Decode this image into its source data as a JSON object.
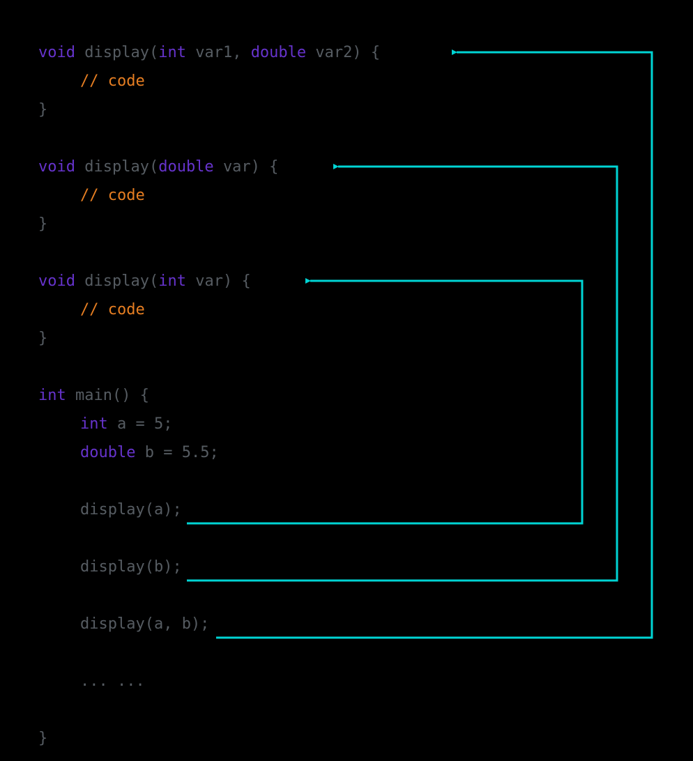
{
  "code": {
    "func1": {
      "ret": "void",
      "name": "display",
      "p1_type": "int",
      "p1_name": "var1",
      "sep": ", ",
      "p2_type": "double",
      "p2_name": "var2",
      "close": ") {",
      "comment": "// code",
      "end": "}"
    },
    "func2": {
      "ret": "void",
      "name": "display",
      "p1_type": "double",
      "p1_name": "var",
      "close": ") {",
      "comment": "// code",
      "end": "}"
    },
    "func3": {
      "ret": "void",
      "name": "display",
      "p1_type": "int",
      "p1_name": "var",
      "close": ") {",
      "comment": "// code",
      "end": "}"
    },
    "main": {
      "ret": "int",
      "name": "main() {",
      "decl1_type": "int",
      "decl1_rest": "a = 5;",
      "decl2_type": "double",
      "decl2_rest": "b = 5.5;",
      "call1": "display(a);",
      "call2": "display(b);",
      "call3": "display(a, b);",
      "ellipsis": "... ...",
      "end": "}"
    }
  },
  "arrows": {
    "color": "#00d4d4",
    "width": 3,
    "paths": [
      {
        "from": "call1",
        "to": "func3"
      },
      {
        "from": "call2",
        "to": "func2"
      },
      {
        "from": "call3",
        "to": "func1"
      }
    ]
  }
}
